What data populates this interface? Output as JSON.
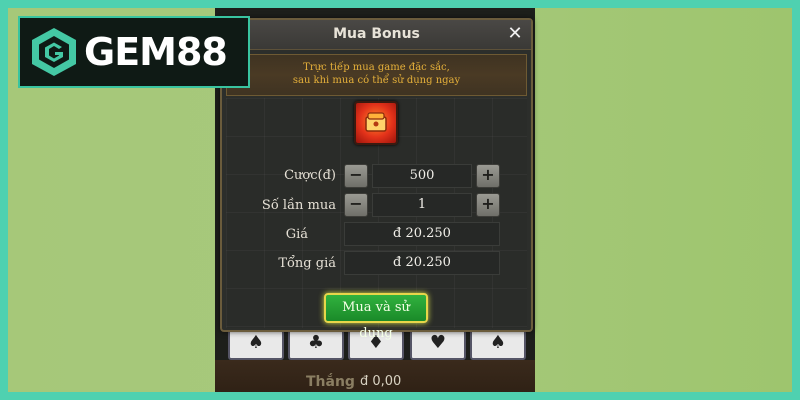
{
  "brand": {
    "name": "GEM88"
  },
  "modal": {
    "title": "Mua Bonus",
    "close": "✕",
    "subtitle_line1": "Trực tiếp mua game đặc sắc,",
    "subtitle_line2": "sau khi mua có thể sử dụng ngay",
    "bet": {
      "label": "Cược(đ)",
      "value": "500",
      "minus": "−",
      "plus": "+"
    },
    "count": {
      "label": "Số lần mua",
      "value": "1",
      "minus": "−",
      "plus": "+"
    },
    "price": {
      "label": "Giá",
      "value": "đ 20.250"
    },
    "total": {
      "label": "Tổng giá",
      "value": "đ 20.250"
    },
    "buy_button": "Mua và sử dụng"
  },
  "game": {
    "cards": [
      "♠",
      "♣",
      "♦",
      "♥",
      "♠"
    ],
    "win_label": "Thắng",
    "win_value": "đ 0,00"
  },
  "colors": {
    "frame_border": "#4fd1b0",
    "background_green": "#a6c879",
    "accent_gold": "#e5b03a",
    "button_green": "#1a8a29"
  }
}
